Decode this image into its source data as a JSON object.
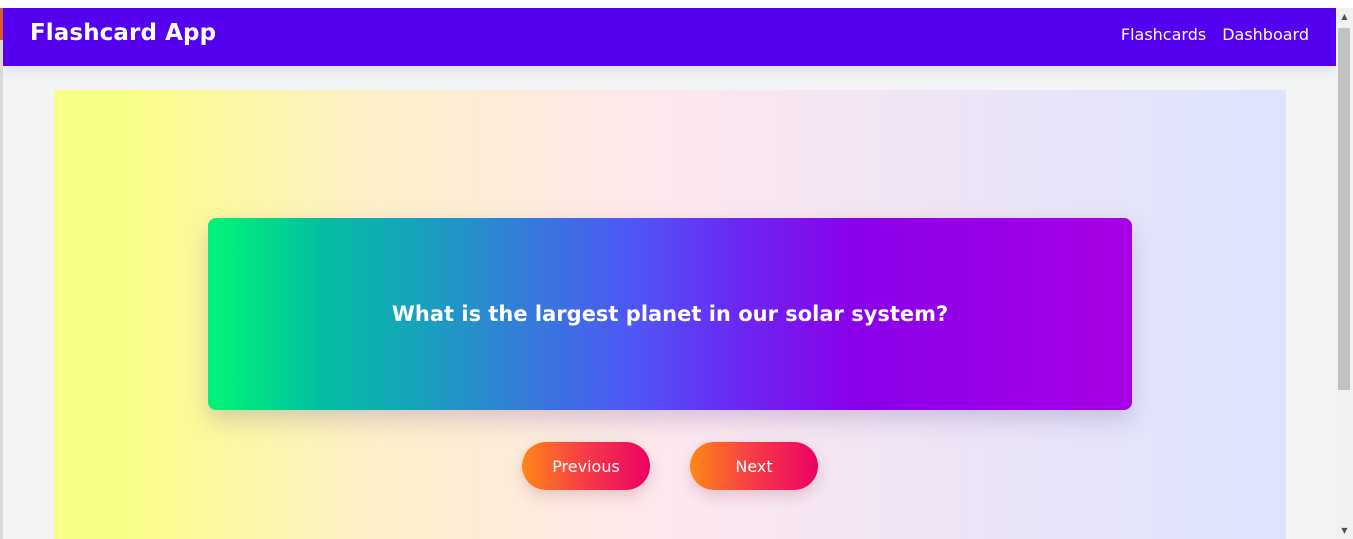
{
  "navbar": {
    "brand": "Flashcard App",
    "links": [
      {
        "label": "Flashcards"
      },
      {
        "label": "Dashboard"
      }
    ],
    "color": "#5500ee"
  },
  "card": {
    "question": "What is the largest planet in our solar system?",
    "gradient_colors": [
      "#00ef7d",
      "#4f56f6",
      "#a700e6"
    ]
  },
  "controls": {
    "previous_label": "Previous",
    "next_label": "Next",
    "button_gradient": [
      "#ff8717",
      "#ec0064"
    ]
  },
  "background_gradient": [
    "#f9ff85",
    "#fee7ef",
    "#dde4ff"
  ],
  "icons": {
    "scroll_up": "▲",
    "scroll_down": "▼"
  }
}
